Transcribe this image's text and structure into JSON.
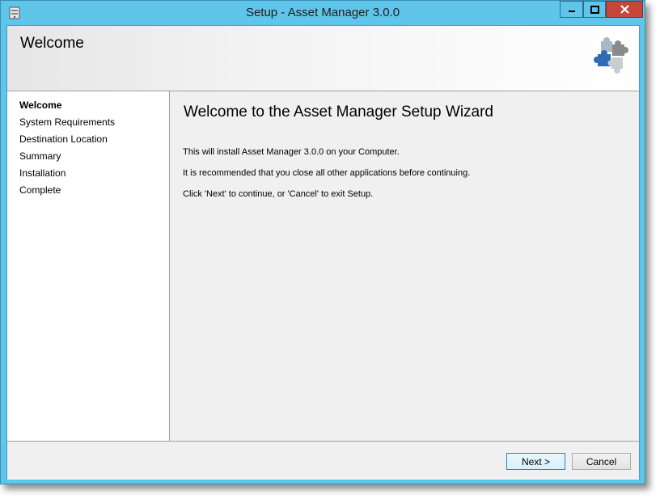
{
  "window": {
    "title": "Setup - Asset Manager 3.0.0",
    "controls": {
      "minimize": "minimize",
      "maximize": "maximize",
      "close": "close"
    }
  },
  "header": {
    "title": "Welcome",
    "icon": "puzzle-pieces-icon"
  },
  "sidebar": {
    "steps": [
      {
        "label": "Welcome",
        "active": true
      },
      {
        "label": "System Requirements",
        "active": false
      },
      {
        "label": "Destination Location",
        "active": false
      },
      {
        "label": "Summary",
        "active": false
      },
      {
        "label": "Installation",
        "active": false
      },
      {
        "label": "Complete",
        "active": false
      }
    ]
  },
  "main": {
    "title": "Welcome to the Asset Manager Setup Wizard",
    "lines": [
      "This will install Asset Manager 3.0.0 on your Computer.",
      "It is recommended that you close all other applications before continuing.",
      "Click 'Next' to continue, or 'Cancel' to exit Setup."
    ]
  },
  "footer": {
    "next_label": "Next >",
    "cancel_label": "Cancel"
  },
  "colors": {
    "title_bar": "#5fc5ea",
    "close_button": "#c7463c",
    "primary_button_border": "#3c7fb1"
  }
}
